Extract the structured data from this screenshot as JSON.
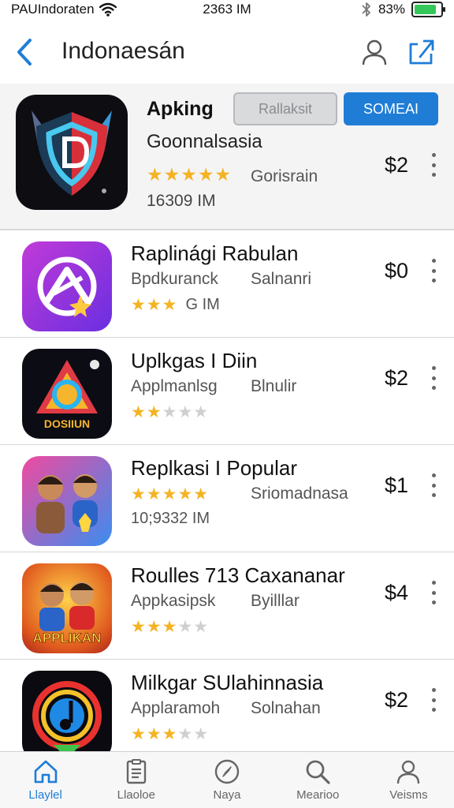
{
  "status_bar": {
    "carrier": "PAUIndoraten",
    "time": "2363 IM",
    "battery_percent": "83%",
    "battery_level": 0.83
  },
  "nav": {
    "title": "Indonaesán",
    "icons": [
      "back-chevron-icon",
      "profile-icon",
      "share-icon"
    ]
  },
  "featured": {
    "name": "Apking",
    "secondary_button": "Rallaksit",
    "primary_button": "SOMEAI",
    "subtitle": "Goonnalsasia",
    "rating": 5,
    "stars": "★★★★★",
    "developer": "Gorisrain",
    "size": "16309 IM",
    "price": "$2"
  },
  "apps": [
    {
      "name": "Raplinági Rabulan",
      "category": "Bpdkuranck",
      "developer": "Salnanri",
      "line3": "G IM",
      "stars_on": "★★★",
      "stars_off": "",
      "rating": 3,
      "price": "$0"
    },
    {
      "name": "Uplkgas I Diin",
      "category": "Applmanlsg",
      "developer": "Blnulir",
      "line3": "",
      "stars_on": "★★",
      "stars_off": "★★★",
      "rating": 2,
      "price": "$2"
    },
    {
      "name": "Replkasi I Popular",
      "category": "",
      "developer": "Sriomadnasa",
      "line3": "10;9332 IM",
      "stars_on": "★★★★★",
      "stars_off": "",
      "rating": 5,
      "price": "$1"
    },
    {
      "name": "Roulles 713 Caxananar",
      "category": "Appkasipsk",
      "developer": "Byilllar",
      "line3": "",
      "stars_on": "★★★",
      "stars_off": "★★",
      "rating": 3,
      "price": "$4"
    },
    {
      "name": "Milkgar SUlahinnasia",
      "category": "Applaramoh",
      "developer": "Solnahan",
      "line3": "",
      "stars_on": "★★★",
      "stars_off": "★★",
      "rating": 3,
      "price": "$2"
    }
  ],
  "app_icon_texts": [
    "DOSIIUN",
    "APPLIKAN"
  ],
  "tabs": [
    {
      "label": "Llaylel",
      "icon": "home-icon",
      "active": true
    },
    {
      "label": "Llaoloe",
      "icon": "list-icon",
      "active": false
    },
    {
      "label": "Naya",
      "icon": "compass-icon",
      "active": false
    },
    {
      "label": "Mearioo",
      "icon": "search-icon",
      "active": false
    },
    {
      "label": "Veisms",
      "icon": "person-icon",
      "active": false
    }
  ],
  "colors": {
    "accent": "#1f7dd6",
    "star": "#f4b323",
    "battery": "#34c759"
  }
}
